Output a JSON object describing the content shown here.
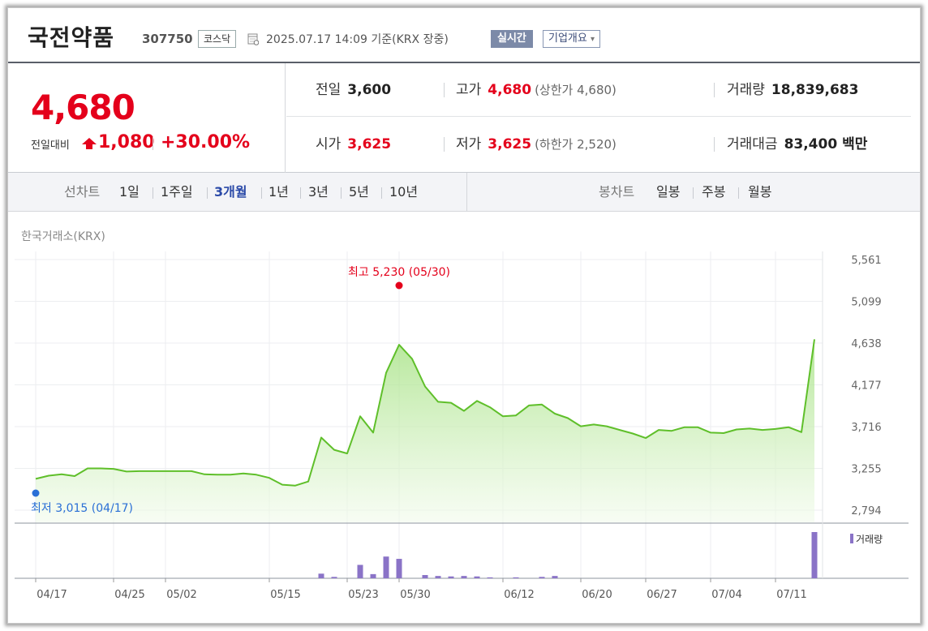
{
  "header": {
    "name": "국전약품",
    "code": "307750",
    "market": "코스닥",
    "datetime": "2025.07.17 14:09 기준(KRX 장중)",
    "realtime_label": "실시간",
    "company_label": "기업개요",
    "company_arrow": "▾"
  },
  "price": {
    "current": "4,680",
    "change_label": "전일대비",
    "change": "1,080",
    "change_pct": "+30.00%"
  },
  "stats": {
    "prev_label": "전일",
    "prev": "3,600",
    "high_label": "고가",
    "high": "4,680",
    "high_sub": "(상한가 4,680)",
    "volume_label": "거래량",
    "volume": "18,839,683",
    "open_label": "시가",
    "open": "3,625",
    "low_label": "저가",
    "low": "3,625",
    "low_sub": "(하한가 2,520)",
    "amount_label": "거래대금",
    "amount": "83,400 백만"
  },
  "tabs": {
    "line_label": "선차트",
    "periods": [
      "1일",
      "1주일",
      "3개월",
      "1년",
      "3년",
      "5년",
      "10년"
    ],
    "selected": "3개월",
    "candle_label": "봉차트",
    "candles": [
      "일봉",
      "주봉",
      "월봉"
    ]
  },
  "chart_source": "한국거래소(KRX)",
  "chart_data": {
    "type": "line",
    "y_ticks": [
      "5,561",
      "5,099",
      "4,638",
      "4,177",
      "3,716",
      "3,255",
      "2,794"
    ],
    "ylim": [
      2794,
      5561
    ],
    "x_labels": [
      "04/17",
      "04/25",
      "05/02",
      "05/15",
      "05/23",
      "05/30",
      "06/12",
      "06/20",
      "06/27",
      "07/04",
      "07/11"
    ],
    "x_label_index": [
      0,
      6,
      10,
      18,
      24,
      28,
      36,
      42,
      47,
      52,
      57
    ],
    "series": [
      {
        "values": [
          3140,
          3175,
          3190,
          3170,
          3255,
          3255,
          3250,
          3220,
          3225,
          3225,
          3225,
          3225,
          3225,
          3190,
          3185,
          3185,
          3200,
          3185,
          3150,
          3075,
          3065,
          3110,
          3595,
          3460,
          3420,
          3830,
          3650,
          4310,
          4620,
          4465,
          4160,
          3990,
          3980,
          3890,
          4000,
          3930,
          3830,
          3840,
          3950,
          3960,
          3860,
          3810,
          3720,
          3740,
          3720,
          3680,
          3640,
          3590,
          3680,
          3670,
          3710,
          3710,
          3650,
          3645,
          3685,
          3695,
          3680,
          3690,
          3710,
          3655,
          4680
        ],
        "color": "#5fbf2a"
      }
    ],
    "volume": {
      "label": "거래량",
      "values": [
        0,
        0,
        0,
        0,
        0,
        0,
        0,
        0,
        0,
        0,
        0,
        0,
        0,
        0,
        0,
        0,
        0,
        0,
        0,
        0,
        0,
        0,
        0.1,
        0.03,
        0,
        0.29,
        0.09,
        0.47,
        0.42,
        0,
        0.07,
        0.05,
        0.04,
        0.05,
        0.04,
        0.02,
        0,
        0.02,
        0,
        0.03,
        0.05,
        0,
        0,
        0,
        0,
        0,
        0,
        0,
        0,
        0,
        0,
        0,
        0,
        0,
        0,
        0,
        0,
        0,
        0,
        0,
        1.0
      ],
      "color": "#8a73c7"
    },
    "max_annotation": {
      "text": "최고 5,230 (05/30)",
      "value": 5230,
      "index": 28,
      "color": "#e4001b"
    },
    "min_annotation": {
      "text": "최저 3,015 (04/17)",
      "value": 3015,
      "index": 0,
      "color": "#2a6fd6"
    },
    "grid": true
  }
}
